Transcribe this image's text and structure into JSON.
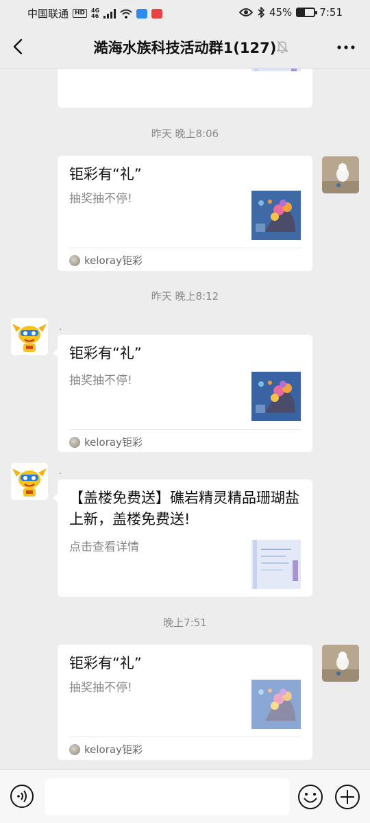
{
  "status_bar": {
    "carrier": "中国联通",
    "hd_badge": "HD",
    "net_top": "4G",
    "net_bottom": "46",
    "battery_percent": "45%",
    "battery_level": 0.45,
    "time": "7:51"
  },
  "header": {
    "title": "澔海水族科技活动群1(127)"
  },
  "chat": {
    "messages": [
      {
        "time": "昨天 晚上8:06",
        "title": "钜彩有“礼”",
        "desc": "抽奖抽不停!",
        "source": "keloray钜彩"
      },
      {
        "time": "昨天 晚上8:12",
        "sender": ".",
        "title": "钜彩有“礼”",
        "desc": "抽奖抽不停!",
        "source": "keloray钜彩"
      },
      {
        "sender": ".",
        "title": "【盖楼免费送】礁岩精灵精品珊瑚盐上新，盖楼免费送!",
        "desc": "点击查看详情"
      },
      {
        "time": "晚上7:51",
        "title": "钜彩有“礼”",
        "desc": "抽奖抽不停!",
        "source": "keloray钜彩"
      }
    ]
  },
  "input": {
    "placeholder": ""
  },
  "icons": {
    "back": "chevron-left-icon",
    "mute": "bell-off-icon",
    "more": "more-dots-icon",
    "voice": "voice-icon",
    "emoji": "emoji-icon",
    "plus": "plus-icon"
  }
}
